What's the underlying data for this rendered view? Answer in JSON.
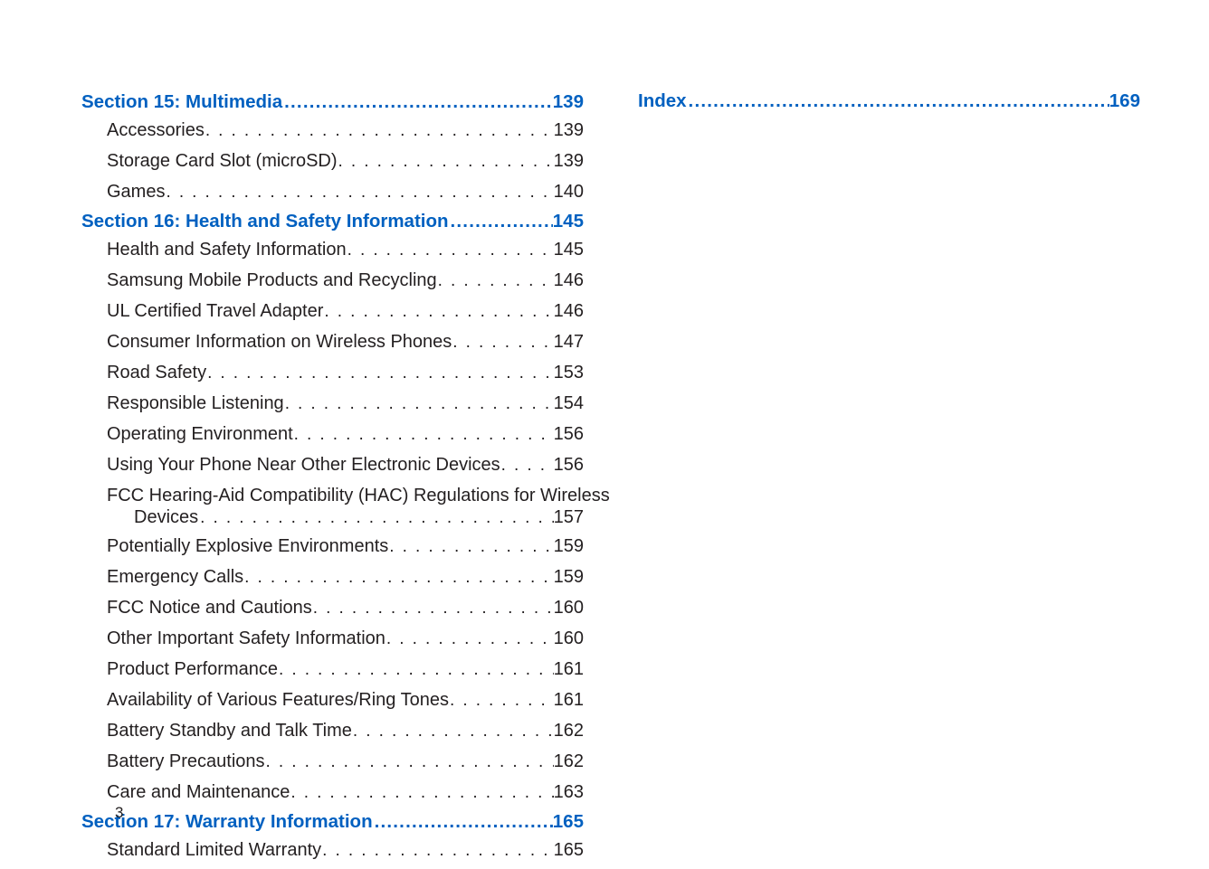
{
  "dots": ". . . . . . . . . . . . . . . . . . . . . . . . . . . . . . . . . . . . . . . . . . . . . . . . . . . . . . . . . . . . . . . . . . . . . . . . . . . . . . . . . . . . .",
  "heading_dots": ".....................................................................................................................",
  "sections": {
    "s15": {
      "title": "Section 15:  Multimedia ",
      "page": "139"
    },
    "s16": {
      "title": "Section 16:  Health and Safety Information ",
      "page": "145"
    },
    "s17": {
      "title": "Section 17:  Warranty Information ",
      "page": "165"
    }
  },
  "entries": {
    "accessories": {
      "title": "Accessories ",
      "page": "139"
    },
    "storage": {
      "title": "Storage Card Slot (microSD) ",
      "page": "139"
    },
    "games": {
      "title": "Games ",
      "page": "140"
    },
    "health_info": {
      "title": "Health and Safety Information",
      "page": "145"
    },
    "samsung_recycling": {
      "title": "Samsung Mobile Products and Recycling ",
      "page": "146"
    },
    "ul_adapter": {
      "title": "UL Certified Travel Adapter ",
      "page": "146"
    },
    "consumer_wireless": {
      "title": "Consumer Information on Wireless Phones ",
      "page": "147"
    },
    "road_safety": {
      "title": "Road Safety ",
      "page": "153"
    },
    "responsible_listening": {
      "title": "Responsible Listening",
      "page": "154"
    },
    "operating_env": {
      "title": "Operating Environment ",
      "page": "156"
    },
    "electronic_devices": {
      "title": "Using Your Phone Near Other Electronic Devices ",
      "page": "156"
    },
    "fcc_hac_line1": {
      "title": "FCC Hearing-Aid Compatibility (HAC) Regulations for Wireless "
    },
    "fcc_hac_line2": {
      "title": "Devices ",
      "page": "157"
    },
    "explosive_env": {
      "title": "Potentially Explosive Environments ",
      "page": "159"
    },
    "emergency": {
      "title": "Emergency Calls",
      "page": "159"
    },
    "fcc_notice": {
      "title": "FCC Notice and Cautions  ",
      "page": "160"
    },
    "other_safety": {
      "title": "Other Important Safety Information",
      "page": "160"
    },
    "product_perf": {
      "title": "Product Performance  ",
      "page": "161"
    },
    "ring_tones": {
      "title": "Availability of Various Features/Ring Tones",
      "page": "161"
    },
    "battery_standby": {
      "title": "Battery Standby and Talk Time ",
      "page": "162"
    },
    "battery_precautions": {
      "title": "Battery Precautions  ",
      "page": "162"
    },
    "care_maintenance": {
      "title": "Care and Maintenance  ",
      "page": "163"
    },
    "standard_warranty": {
      "title": "Standard Limited Warranty ",
      "page": "165"
    }
  },
  "index": {
    "title": "Index ",
    "page": "169"
  },
  "footer_page": "3"
}
